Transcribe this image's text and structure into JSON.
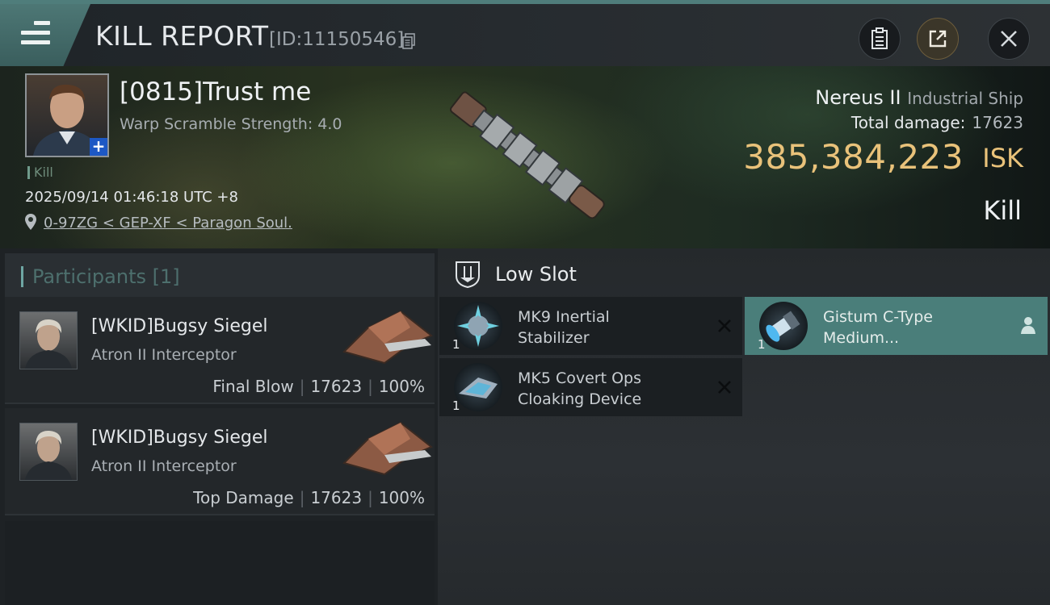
{
  "header": {
    "title": "KILL REPORT",
    "report_id": "[ID:11150546]",
    "icons": [
      "menu-icon",
      "copy-icon",
      "clipboard-icon",
      "share-icon",
      "close-icon"
    ]
  },
  "victim": {
    "name": "[0815]Trust me",
    "warp": "Warp Scramble Strength: 4.0",
    "tag": "Kill",
    "datetime": "2025/09/14 01:46:18 UTC +8",
    "location": "0-97ZG < GEP-XF < Paragon Soul.",
    "ship": "Nereus II",
    "ship_class": "Industrial Ship",
    "total_damage_label": "Total damage:",
    "total_damage": "17623",
    "isk_value": "385,384,223",
    "isk_unit": "ISK",
    "result": "Kill"
  },
  "participants": {
    "header": "Participants [1]",
    "rows": [
      {
        "name": "[WKID]Bugsy Siegel",
        "ship": "Atron II Interceptor",
        "role": "Final Blow",
        "damage": "17623",
        "percent": "100%"
      },
      {
        "name": "[WKID]Bugsy Siegel",
        "ship": "Atron II Interceptor",
        "role": "Top Damage",
        "damage": "17623",
        "percent": "100%"
      }
    ]
  },
  "modules": {
    "slot_label": "Low Slot",
    "items": [
      {
        "name_line1": "MK9 Inertial",
        "name_line2": "Stabilizer",
        "qty": "1",
        "status": "destroyed"
      },
      {
        "name_line1": "Gistum C-Type",
        "name_line2": "Medium...",
        "qty": "1",
        "status": "dropped"
      },
      {
        "name_line1": "MK5 Covert Ops",
        "name_line2": "Cloaking Device",
        "qty": "1",
        "status": "destroyed"
      }
    ]
  },
  "colors": {
    "accent": "#4f7d7b",
    "isk": "#e9c27a",
    "highlight": "#4a7e7a"
  }
}
